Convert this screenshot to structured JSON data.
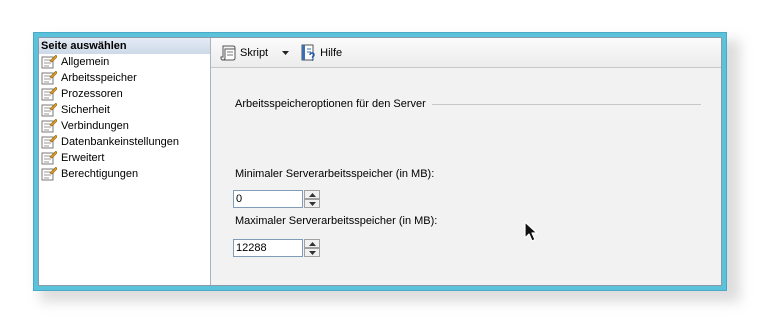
{
  "left_panel": {
    "header": "Seite auswählen",
    "items": [
      {
        "label": "Allgemein"
      },
      {
        "label": "Arbeitsspeicher"
      },
      {
        "label": "Prozessoren"
      },
      {
        "label": "Sicherheit"
      },
      {
        "label": "Verbindungen"
      },
      {
        "label": "Datenbankeinstellungen"
      },
      {
        "label": "Erweitert"
      },
      {
        "label": "Berechtigungen"
      }
    ]
  },
  "toolbar": {
    "script_label": "Skript",
    "help_label": "Hilfe"
  },
  "main": {
    "section_title": "Arbeitsspeicheroptionen für den Server",
    "min_label": "Minimaler Serverarbeitsspeicher (in MB):",
    "min_value": "0",
    "max_label": "Maximaler Serverarbeitsspeicher (in MB):",
    "max_value": "12288"
  },
  "colors": {
    "frame": "#5bc2dc",
    "header_bg": "#cdd9e7",
    "pane_bg": "#f2f2f2"
  },
  "icons": {
    "nav_item": "page-wrench-icon",
    "script": "script-icon",
    "help": "help-icon",
    "cursor": "mouse-cursor-icon"
  }
}
